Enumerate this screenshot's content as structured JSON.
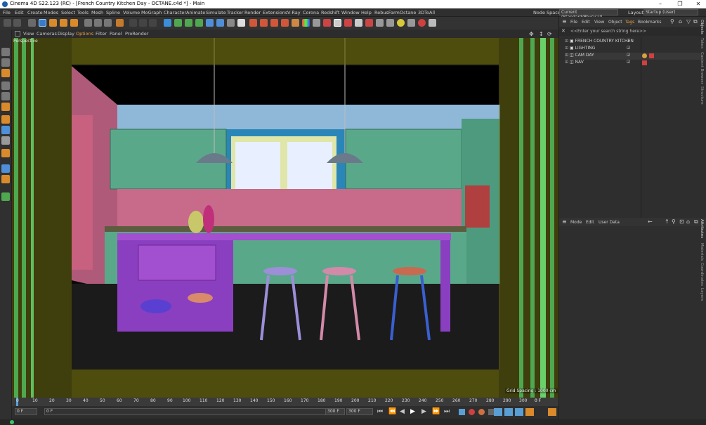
{
  "window": {
    "title": "Cinema 4D S22.123 (RC) - [French Country Kitchen Day - OCTANE.c4d *] - Main",
    "minimize": "–",
    "maximize": "❐",
    "close": "✕"
  },
  "menu": {
    "items": [
      "File",
      "Edit",
      "Create",
      "Modes",
      "Select",
      "Tools",
      "Mesh",
      "Spline",
      "Volume",
      "MoGraph",
      "Character",
      "Animate",
      "Simulate",
      "Tracker",
      "Render",
      "Extensions",
      "V-Ray",
      "Corona",
      "Redshift",
      "Window",
      "Help",
      "RebusFarm",
      "Octane",
      "3DToAll"
    ],
    "node_space_label": "Node Space:",
    "node_space_value": "Current (Standard/Physical)",
    "layout_label": "Layout:",
    "layout_value": "Startup (User)"
  },
  "viewport": {
    "menu": [
      "View",
      "Cameras",
      "Display",
      "Options",
      "Filter",
      "Panel",
      "ProRender"
    ],
    "active_menu": "Options",
    "label": "Perspective",
    "grid_spacing": "Grid Spacing : 1000 cm"
  },
  "timeline": {
    "ticks": [
      "0",
      "10",
      "20",
      "30",
      "40",
      "50",
      "60",
      "70",
      "80",
      "90",
      "100",
      "110",
      "120",
      "130",
      "140",
      "150",
      "160",
      "170",
      "180",
      "190",
      "200",
      "210",
      "220",
      "230",
      "240",
      "250",
      "260",
      "270",
      "280",
      "290",
      "300"
    ],
    "end_frame": "0 F"
  },
  "transport": {
    "current_frame": "0 F",
    "start_frame": "0 F",
    "end_frame_a": "300 F",
    "end_frame_b": "300 F"
  },
  "object_manager": {
    "menu": [
      "File",
      "Edit",
      "View",
      "Object",
      "Tags",
      "Bookmarks"
    ],
    "active_menu": "Tags",
    "search_placeholder": "<<Enter your search string here>>",
    "objects": [
      {
        "name": "FRENCH COUNTRY KITCHEN"
      },
      {
        "name": "LIGHTING"
      },
      {
        "name": "CAM DAY"
      },
      {
        "name": "NAV"
      }
    ]
  },
  "attributes": {
    "menu": [
      "Mode",
      "Edit",
      "User Data"
    ]
  },
  "side_tabs_top": [
    "Objects",
    "Takes",
    "Content Browser",
    "Structure"
  ],
  "side_tabs_bottom": [
    "Attributes",
    "Materials",
    "Coordinates",
    "Layers"
  ],
  "colors": {
    "accent": "#5a9fd4",
    "safe_frame": "#6b6a10",
    "green_guides": "#4fa84f",
    "wall": "#2a86b8",
    "cabinet": "#5aa88a",
    "island": "#a24fd0"
  }
}
